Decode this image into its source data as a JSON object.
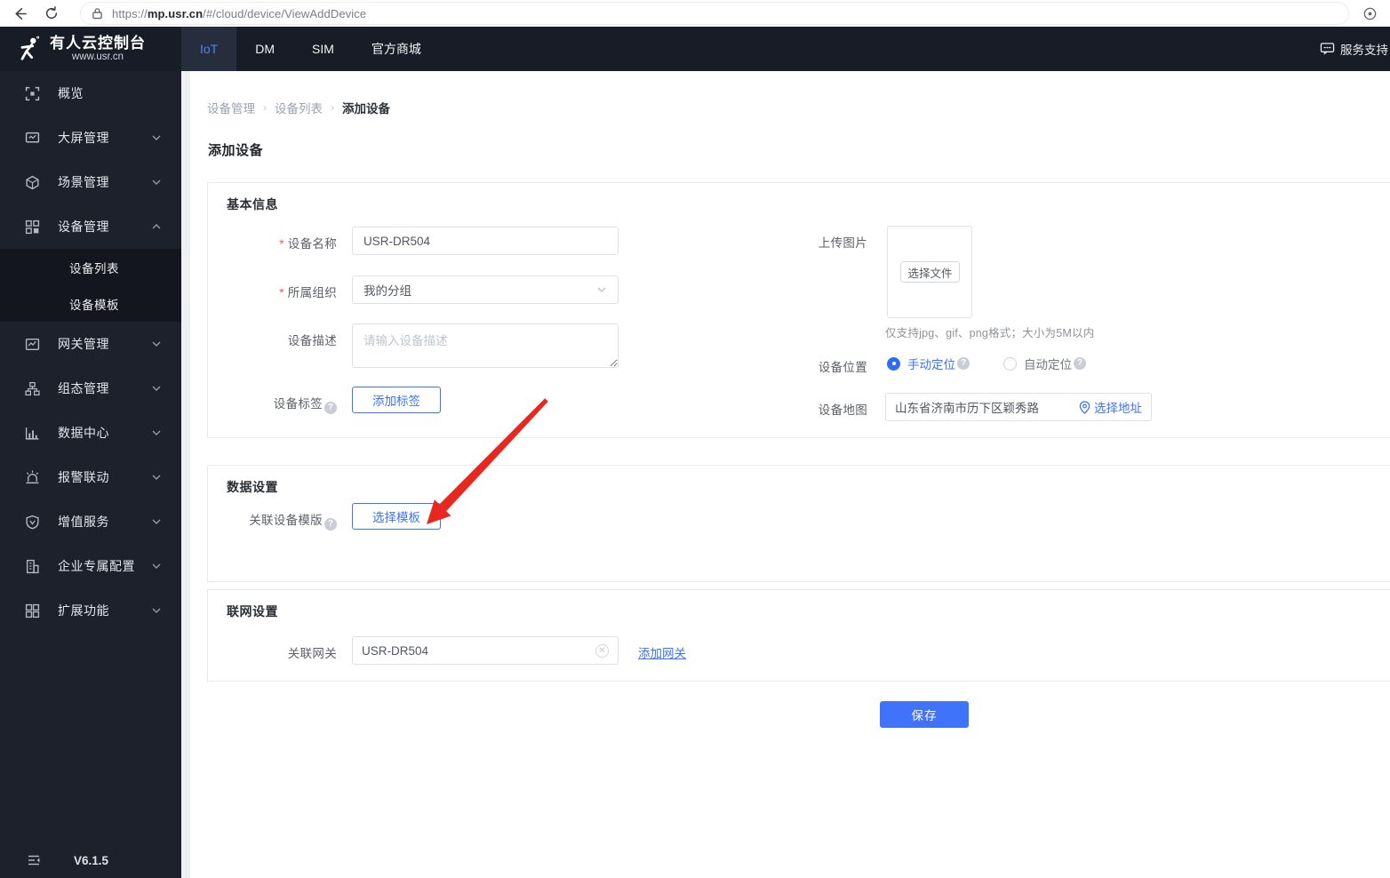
{
  "browser": {
    "url_scheme": "https://",
    "url_host": "mp.usr.cn",
    "url_path": "/#/cloud/device/ViewAddDevice"
  },
  "topnav": {
    "logo_title": "有人云控制台",
    "logo_subtitle": "www.usr.cn",
    "tabs": [
      {
        "label": "IoT"
      },
      {
        "label": "DM"
      },
      {
        "label": "SIM"
      },
      {
        "label": "官方商城"
      }
    ],
    "support_label": "服务支持"
  },
  "sidebar": {
    "items": [
      {
        "label": "概览"
      },
      {
        "label": "大屏管理"
      },
      {
        "label": "场景管理"
      },
      {
        "label": "设备管理"
      },
      {
        "label": "网关管理"
      },
      {
        "label": "组态管理"
      },
      {
        "label": "数据中心"
      },
      {
        "label": "报警联动"
      },
      {
        "label": "增值服务"
      },
      {
        "label": "企业专属配置"
      },
      {
        "label": "扩展功能"
      }
    ],
    "submenu": [
      {
        "label": "设备列表"
      },
      {
        "label": "设备模板"
      }
    ],
    "version": "V6.1.5"
  },
  "breadcrumb": {
    "0": "设备管理",
    "1": "设备列表",
    "2": "添加设备"
  },
  "page": {
    "title": "添加设备"
  },
  "basic_info": {
    "section_title": "基本信息",
    "device_name_label": "设备名称",
    "device_name_value": "USR-DR504",
    "org_label": "所属组织",
    "org_value": "我的分组",
    "desc_label": "设备描述",
    "desc_placeholder": "请输入设备描述",
    "tag_label": "设备标签",
    "add_tag_button": "添加标签",
    "upload_label": "上传图片",
    "choose_file_button": "选择文件",
    "upload_hint": "仅支持jpg、gif、png格式；大小为5M以内",
    "location_label": "设备位置",
    "manual_location": "手动定位",
    "auto_location": "自动定位",
    "map_label": "设备地图",
    "map_value": "山东省济南市历下区颖秀路",
    "select_address_link": "选择地址"
  },
  "data_settings": {
    "section_title": "数据设置",
    "template_label": "关联设备模版",
    "select_template_button": "选择模板"
  },
  "network_settings": {
    "section_title": "联网设置",
    "gateway_label": "关联网关",
    "gateway_value": "USR-DR504",
    "add_gateway_link": "添加网关"
  },
  "footer": {
    "save_button": "保存"
  },
  "colors": {
    "accent": "#3d74f6",
    "save_button": "#4073fa",
    "arrow": "#e8281e",
    "sidebar_bg": "#1d212c",
    "topnav_bg": "#181c26"
  }
}
